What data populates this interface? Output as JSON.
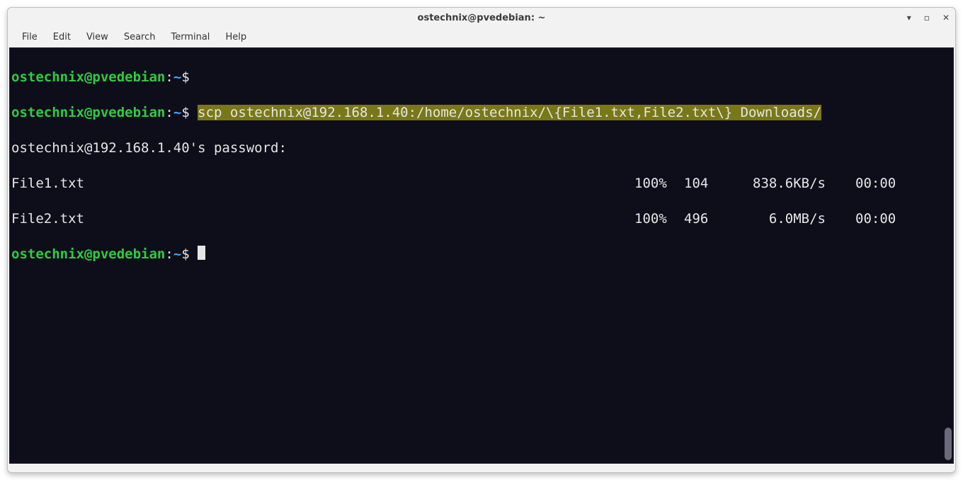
{
  "window": {
    "title": "ostechnix@pvedebian: ~"
  },
  "window_controls": {
    "min": "_",
    "max": "□",
    "close": "×"
  },
  "menu": {
    "file": "File",
    "edit": "Edit",
    "view": "View",
    "search": "Search",
    "terminal": "Terminal",
    "help": "Help"
  },
  "prompt": {
    "user": "ostechnix",
    "at": "@",
    "host": "pvedebian",
    "colon": ":",
    "path": "~",
    "dollar": "$"
  },
  "lines": {
    "l1_cmd": "",
    "l2_cmd": "scp ostechnix@192.168.1.40:/home/ostechnix/\\{File1.txt,File2.txt\\} Downloads/",
    "l3": "ostechnix@192.168.1.40's password:"
  },
  "transfers": [
    {
      "name": "File1.txt",
      "pct": "100%",
      "bytes": "104",
      "speed": "838.6KB/s",
      "eta": "00:00"
    },
    {
      "name": "File2.txt",
      "pct": "100%",
      "bytes": "496",
      "speed": "6.0MB/s",
      "eta": "00:00"
    }
  ]
}
